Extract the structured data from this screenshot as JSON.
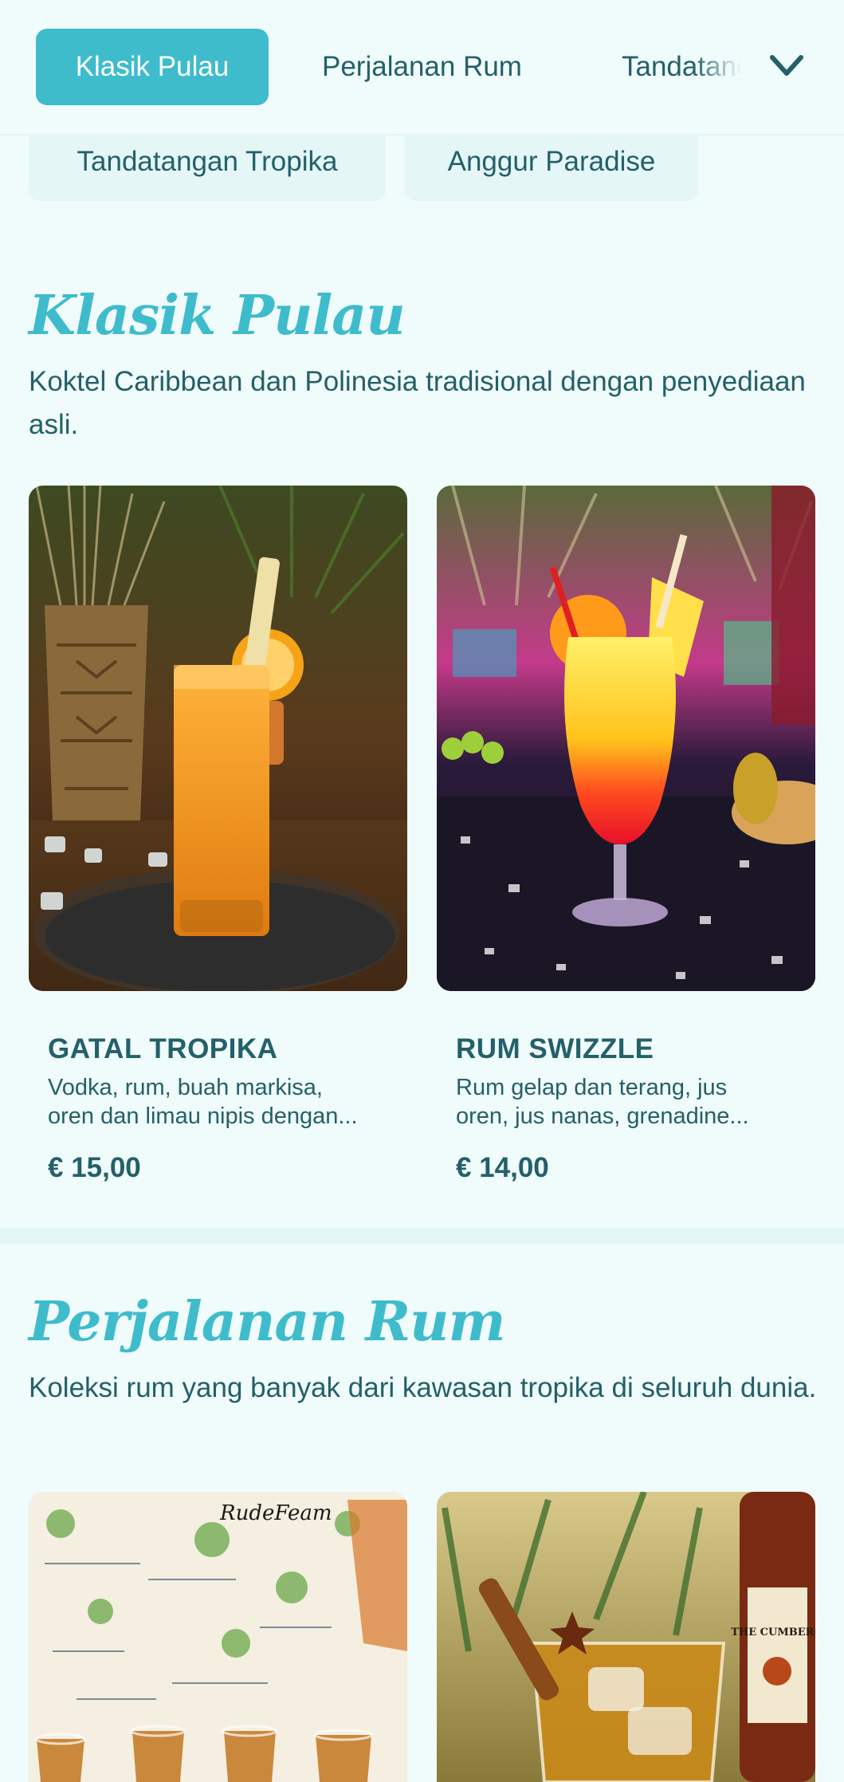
{
  "nav": {
    "tabs": [
      {
        "label": "Klasik Pulau",
        "active": true
      },
      {
        "label": "Perjalanan Rum",
        "active": false
      },
      {
        "label": "Tandatangan Tropika",
        "active": false
      }
    ],
    "sub_tabs": [
      {
        "label": "Tandatangan Tropika"
      },
      {
        "label": "Anggur Paradise"
      }
    ],
    "expand_icon": "chevron-down-icon"
  },
  "sections": [
    {
      "title": "Klasik Pulau",
      "description": "Koktel Caribbean dan Polinesia tradisional dengan penyediaan asli.",
      "items": [
        {
          "name": "GATAL TROPIKA",
          "description_line1": "Vodka, rum, buah markisa,",
          "description_line2": "oren dan limau nipis dengan...",
          "price": "€ 15,00"
        },
        {
          "name": "RUM SWIZZLE",
          "description_line1": "Rum gelap dan terang, jus",
          "description_line2": "oren, jus nanas, grenadine...",
          "price": "€ 14,00"
        }
      ]
    },
    {
      "title": "Perjalanan Rum",
      "description": "Koleksi rum yang banyak dari kawasan tropika di seluruh dunia.",
      "items": [
        {
          "image_text": "RudeFeam"
        },
        {
          "image_text": "THE CUMBERO"
        }
      ]
    }
  ],
  "colors": {
    "accent": "#3fbccc",
    "text": "#23606a",
    "background": "#f0fbfb"
  }
}
